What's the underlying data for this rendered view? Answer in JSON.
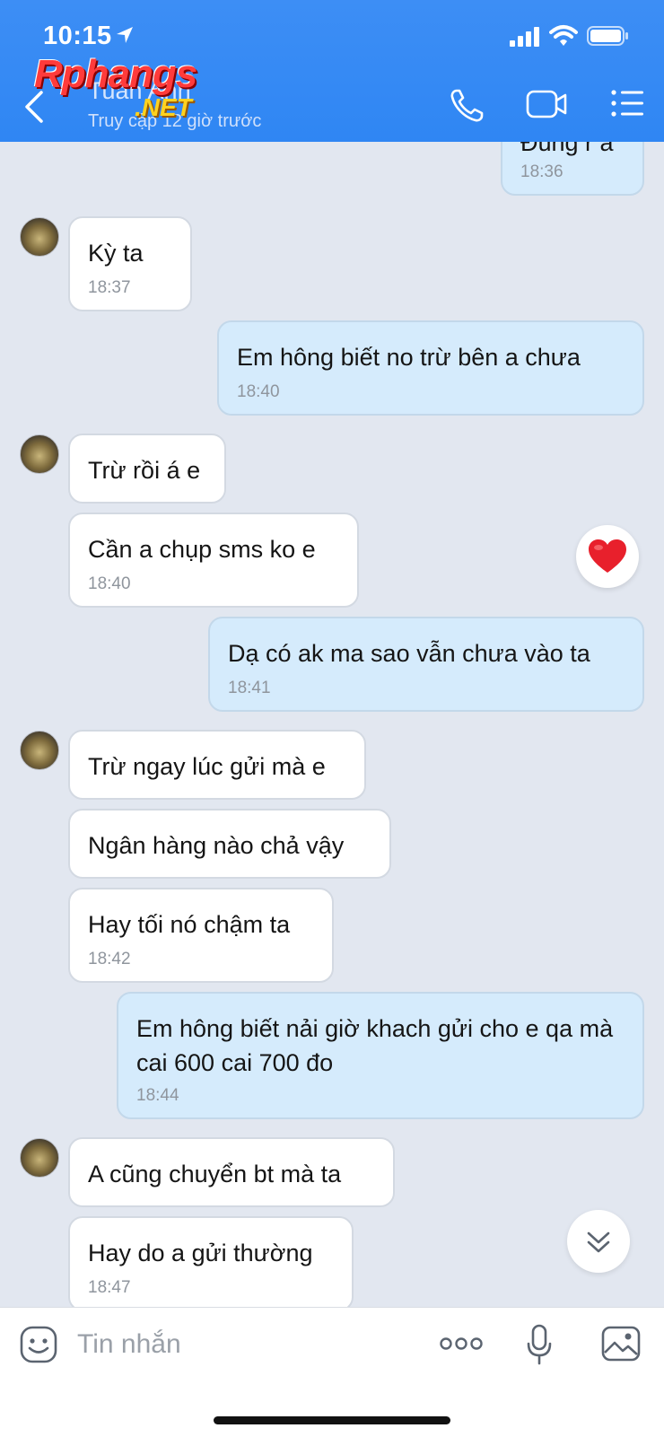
{
  "status_bar": {
    "time": "10:15"
  },
  "logo": {
    "main": "Rphangs",
    "suffix": ".NET"
  },
  "header": {
    "contact_name": "Tuan Anh",
    "last_seen": "Truy cập 12 giờ trước"
  },
  "messages": [
    {
      "direction": "out",
      "text": "Đúng r à",
      "time": "18:36"
    },
    {
      "direction": "in",
      "text": "Kỳ ta",
      "time": "18:37"
    },
    {
      "direction": "out",
      "text": "Em hông biết no trừ bên a chưa",
      "time": "18:40"
    },
    {
      "direction": "in",
      "text": "Trừ rồi á e",
      "time": ""
    },
    {
      "direction": "in",
      "text": "Cần a chụp sms ko e",
      "time": "18:40"
    },
    {
      "direction": "out",
      "text": "Dạ có ak ma sao vẫn chưa vào ta",
      "time": "18:41"
    },
    {
      "direction": "in",
      "text": "Trừ ngay lúc gửi mà e",
      "time": ""
    },
    {
      "direction": "in",
      "text": "Ngân hàng nào chả vậy",
      "time": ""
    },
    {
      "direction": "in",
      "text": "Hay tối nó chậm ta",
      "time": "18:42"
    },
    {
      "direction": "out",
      "text": "Em hông biết nải giờ khach gửi cho e qa mà cai 600 cai 700 đo",
      "time": "18:44"
    },
    {
      "direction": "in",
      "text": "A cũng chuyển bt mà ta",
      "time": ""
    },
    {
      "direction": "in",
      "text": "Hay do a gửi thường",
      "time": "18:47"
    }
  ],
  "reaction": {
    "icon": "heart-icon",
    "color": "#e8202c"
  },
  "composer": {
    "placeholder": "Tin nhắn"
  },
  "colors": {
    "header": "#2f86f3",
    "outgoing_bubble": "#d5ebfc",
    "incoming_bubble": "#ffffff",
    "background": "#e2e7f0"
  }
}
